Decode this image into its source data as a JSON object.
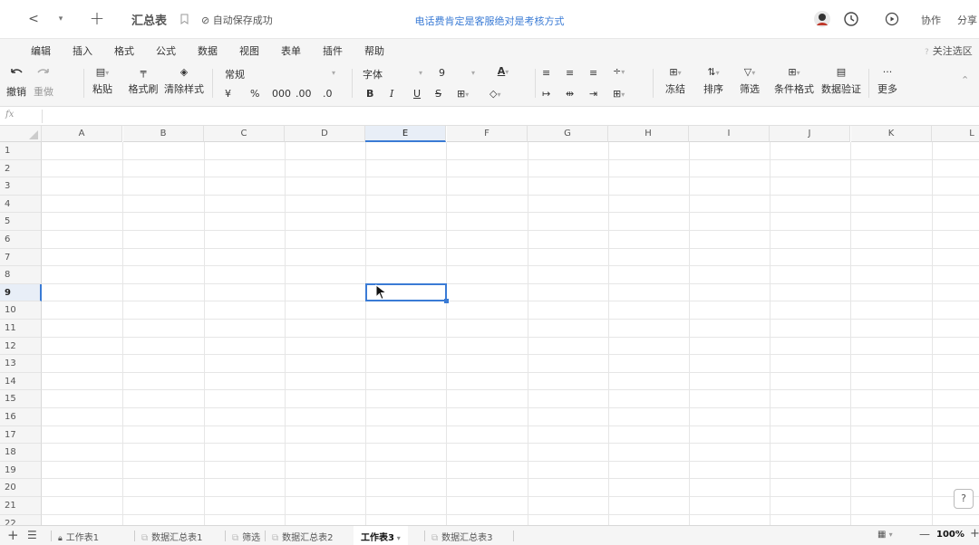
{
  "titlebar": {
    "back_glyph": "<",
    "dropdown_glyph": "▾",
    "add_glyph": "+",
    "doc_title": "汇总表",
    "save_status": "⊘ 自动保存成功",
    "notice": "电话费肯定是客服绝对是考核方式",
    "collaborate_label": "协作",
    "share_label": "分享"
  },
  "menu": {
    "items": [
      "编辑",
      "插入",
      "格式",
      "公式",
      "数据",
      "视图",
      "表单",
      "插件",
      "帮助"
    ],
    "focus_label": "关注选区"
  },
  "toolbar": {
    "undo": "撤销",
    "redo": "重做",
    "paste": "粘贴",
    "format_painter": "格式刷",
    "clear_format": "清除样式",
    "number_format": "常规",
    "currency": "¥",
    "percent": "%",
    "thousands": "000",
    "dec_increase": ".00",
    "dec_decrease": ".0",
    "font_name": "字体",
    "font_size": "9",
    "bold": "B",
    "italic": "I",
    "underline": "U",
    "strike": "S",
    "freeze": "冻结",
    "sort": "排序",
    "filter": "筛选",
    "conditional_format": "条件格式",
    "data_validation": "数据验证",
    "more": "更多",
    "more_glyph": "···"
  },
  "formula": {
    "fx_label": "fx"
  },
  "grid": {
    "columns": [
      "A",
      "B",
      "C",
      "D",
      "E",
      "F",
      "G",
      "H",
      "I",
      "J",
      "K",
      "L"
    ],
    "rows": [
      "1",
      "2",
      "3",
      "4",
      "5",
      "6",
      "7",
      "8",
      "9",
      "10",
      "11",
      "12",
      "13",
      "14",
      "15",
      "16",
      "17",
      "18",
      "19",
      "20",
      "21",
      "22"
    ],
    "active_column": "E",
    "active_row": "9"
  },
  "sheets": {
    "tabs": [
      {
        "label": "工作表1",
        "locked": true
      },
      {
        "label": "数据汇总表1",
        "locked": false
      },
      {
        "label": "筛选",
        "locked": false
      },
      {
        "label": "数据汇总表2",
        "locked": false
      },
      {
        "label": "工作表3",
        "locked": false,
        "active": true
      },
      {
        "label": "数据汇总表3",
        "locked": false
      }
    ],
    "zoom": "100%",
    "add_glyph": "+",
    "list_glyph": "☰",
    "zoom_minus": "—",
    "zoom_plus": "+"
  },
  "help_glyph": "?"
}
